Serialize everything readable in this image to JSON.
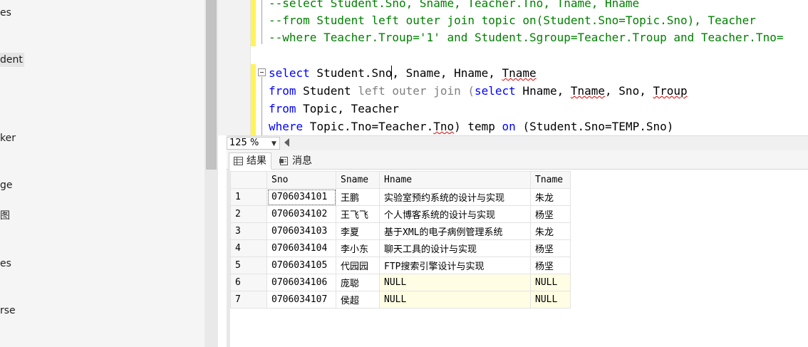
{
  "explorer": {
    "items": [
      {
        "label": "es",
        "selected": false
      },
      {
        "label": "dent",
        "selected": true
      },
      {
        "label": "ker",
        "selected": false
      },
      {
        "label": "ge",
        "selected": false
      },
      {
        "label": "图",
        "selected": false
      },
      {
        "label": "es",
        "selected": false
      },
      {
        "label": "rse",
        "selected": false
      }
    ]
  },
  "editor": {
    "comment_lines": [
      "--select Student.Sno, Sname, Teacher.Tno, Tname, Hname",
      "--from Student left outer join topic on(Student.Sno=Topic.Sno), Teacher",
      "--where Teacher.Troup='1' and Student.Sgroup=Teacher.Troup and Teacher.Tno="
    ],
    "query": {
      "l1_kw": "select",
      "l1_a": " Student.Sno, Sname, Hname, ",
      "l1_b": "Tname",
      "l2_kw": "from",
      "l2_a": " Student ",
      "l2_g": "left outer join (",
      "l2_kw2": "select",
      "l2_b": " Hname, ",
      "l2_c": "Tname",
      "l2_d": ", Sno, ",
      "l2_e": "Troup",
      "l3_kw": "from",
      "l3_a": " Topic, Teacher",
      "l4_kw": "where",
      "l4_a": " Topic.Tno=Teacher.",
      "l4_b": "Tno",
      "l4_c": ") temp ",
      "l4_kw2": "on",
      "l4_d": " (Student.Sno=TEMP.Sno)"
    }
  },
  "zoom": {
    "value": "125 %"
  },
  "result_tabs": {
    "results": "结果",
    "messages": "消息"
  },
  "grid": {
    "columns": [
      "Sno",
      "Sname",
      "Hname",
      "Tname"
    ],
    "rows": [
      {
        "n": "1",
        "sno": "0706034101",
        "sname": "王鹏",
        "hname": "实验室预约系统的设计与实现",
        "tname": "朱龙"
      },
      {
        "n": "2",
        "sno": "0706034102",
        "sname": "王飞飞",
        "hname": "个人博客系统的设计与实现",
        "tname": "杨坚"
      },
      {
        "n": "3",
        "sno": "0706034103",
        "sname": "李夏",
        "hname": "基于XML的电子病例管理系统",
        "tname": "朱龙"
      },
      {
        "n": "4",
        "sno": "0706034104",
        "sname": "李小东",
        "hname": "聊天工具的设计与实现",
        "tname": "杨坚"
      },
      {
        "n": "5",
        "sno": "0706034105",
        "sname": "代园园",
        "hname": "FTP搜索引擎设计与实现",
        "tname": "杨坚"
      },
      {
        "n": "6",
        "sno": "0706034106",
        "sname": "庞聪",
        "hname": "NULL",
        "tname": "NULL"
      },
      {
        "n": "7",
        "sno": "0706034107",
        "sname": "侯超",
        "hname": "NULL",
        "tname": "NULL"
      }
    ]
  },
  "colors": {
    "keyword": "#0000ff",
    "comment": "#008000",
    "change_bar": "#fff35a",
    "null_cell": "#fffde3"
  }
}
